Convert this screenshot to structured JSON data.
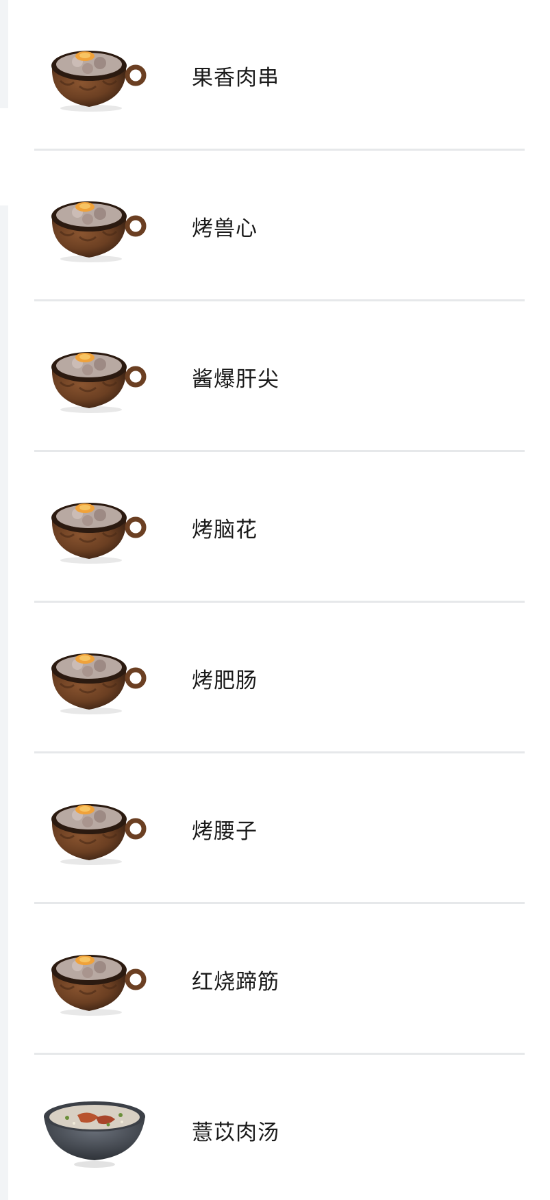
{
  "items": [
    {
      "name": "果香肉串",
      "icon": "clay-pot-dish-icon"
    },
    {
      "name": "烤兽心",
      "icon": "clay-pot-dish-icon"
    },
    {
      "name": "酱爆肝尖",
      "icon": "clay-pot-dish-icon"
    },
    {
      "name": "烤脑花",
      "icon": "clay-pot-dish-icon"
    },
    {
      "name": "烤肥肠",
      "icon": "clay-pot-dish-icon"
    },
    {
      "name": "烤腰子",
      "icon": "clay-pot-dish-icon"
    },
    {
      "name": "红烧蹄筋",
      "icon": "clay-pot-dish-icon"
    },
    {
      "name": "薏苡肉汤",
      "icon": "soup-bowl-icon"
    }
  ],
  "colors": {
    "pot_brown": "#6b3f22",
    "divider": "#e6e8ea",
    "side_strip": "#f2f4f6",
    "bowl_gray": "#4a4f57"
  }
}
